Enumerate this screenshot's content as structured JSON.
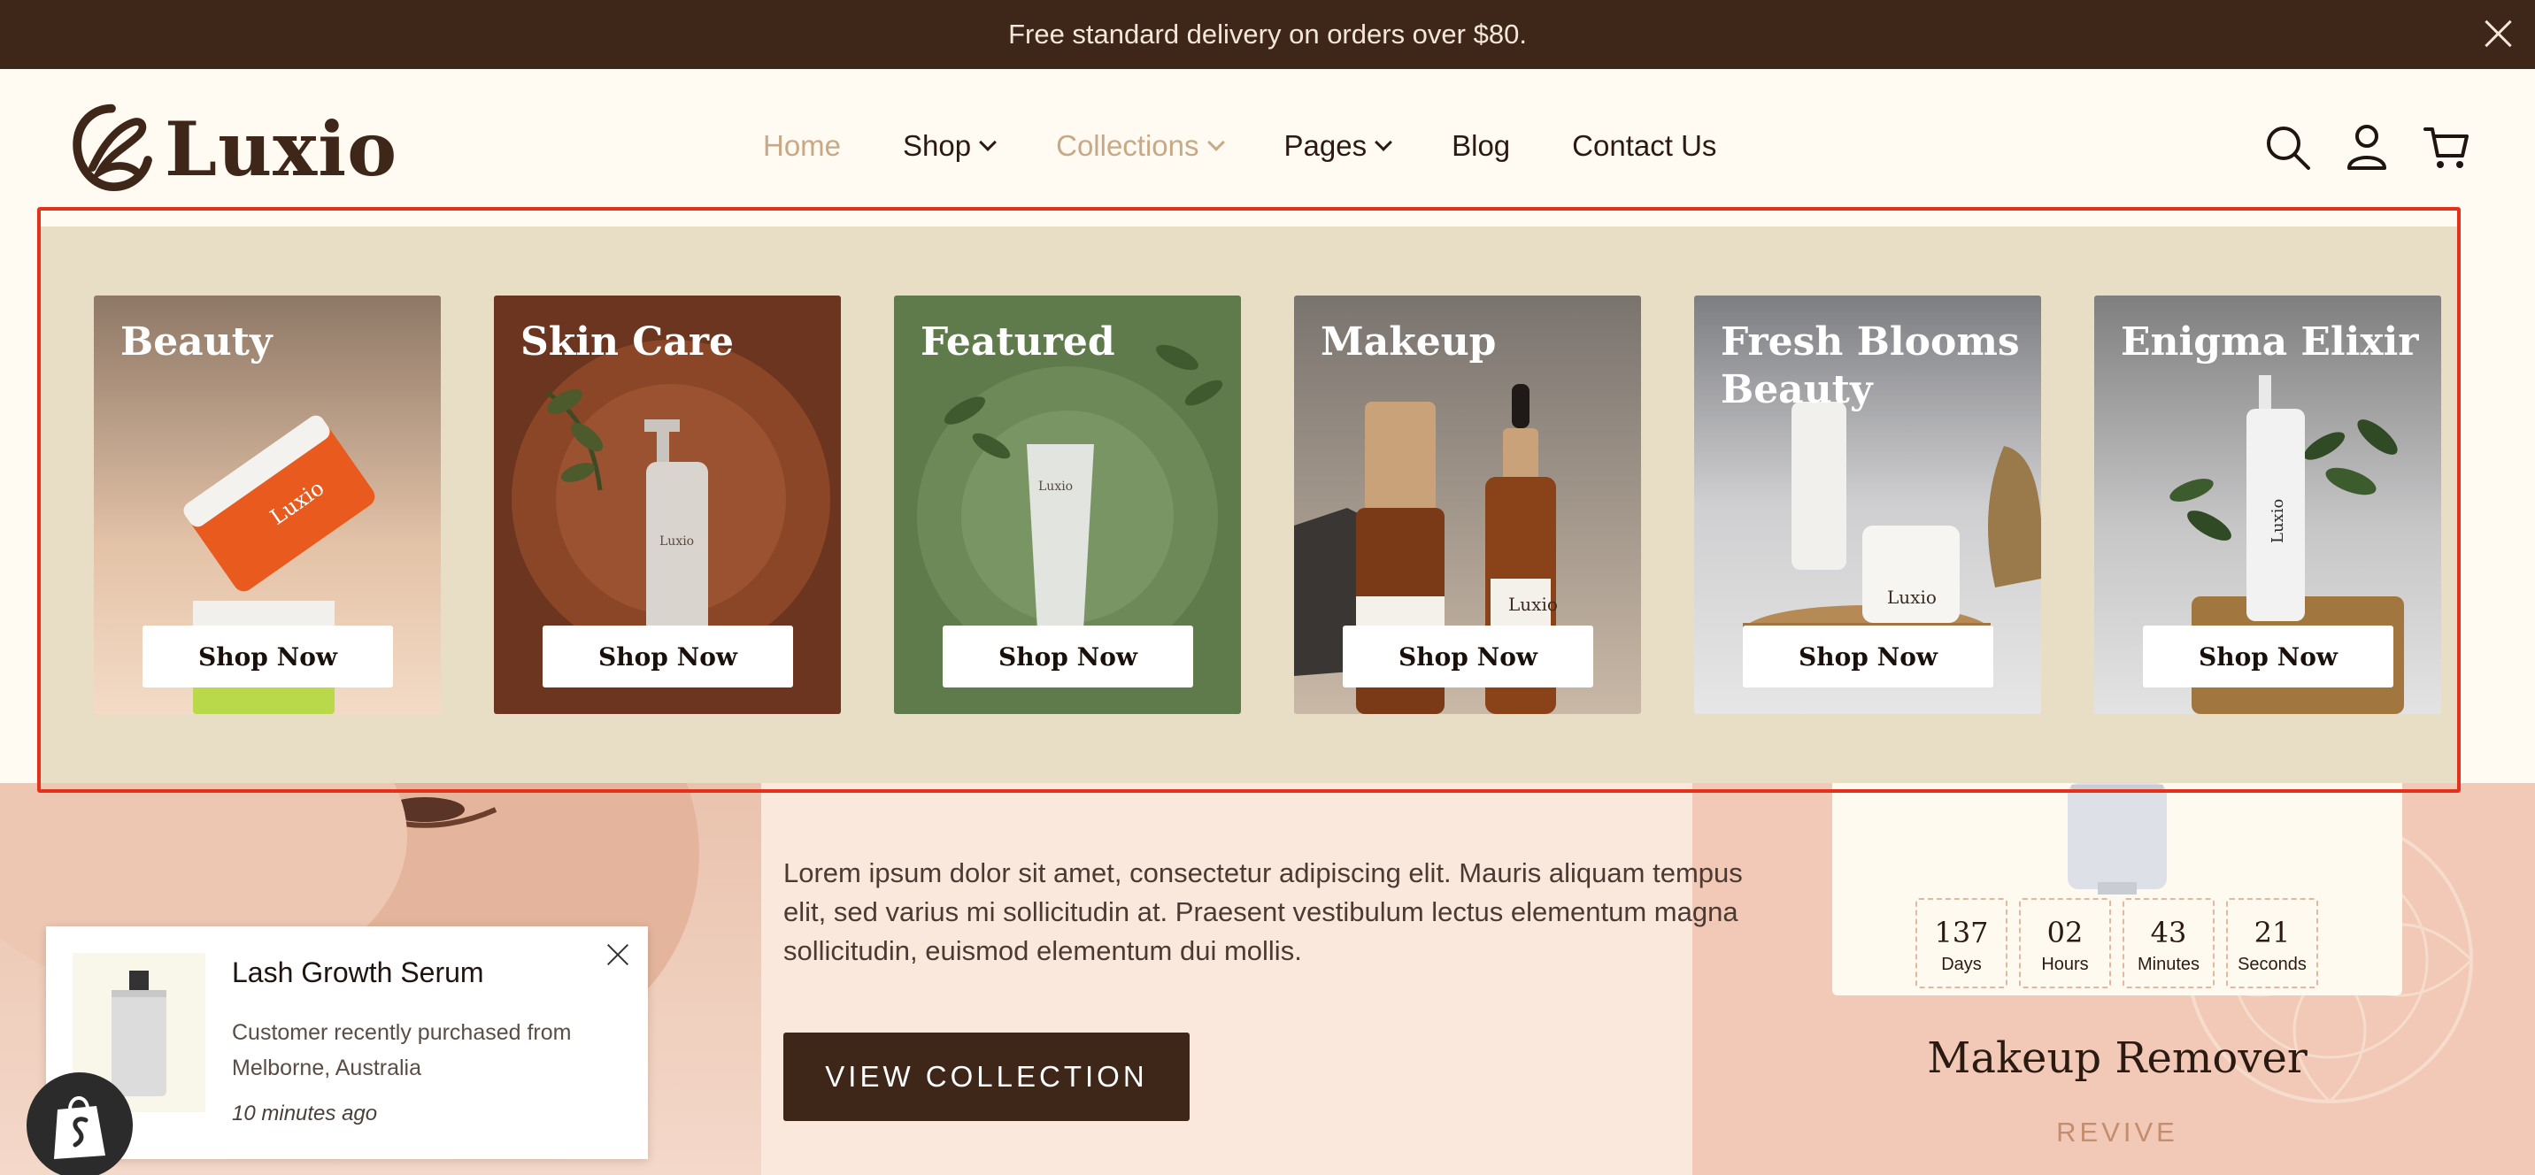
{
  "announcement": {
    "text": "Free standard delivery on orders over $80."
  },
  "brand": {
    "name": "Luxio"
  },
  "nav": {
    "items": [
      {
        "label": "Home"
      },
      {
        "label": "Shop"
      },
      {
        "label": "Collections"
      },
      {
        "label": "Pages"
      },
      {
        "label": "Blog"
      },
      {
        "label": "Contact Us"
      }
    ]
  },
  "collections": [
    {
      "title": "Beauty",
      "button": "Shop Now"
    },
    {
      "title": "Skin Care",
      "button": "Shop Now"
    },
    {
      "title": "Featured",
      "button": "Shop Now"
    },
    {
      "title": "Makeup",
      "button": "Shop Now"
    },
    {
      "title": "Fresh Blooms Beauty",
      "button": "Shop Now"
    },
    {
      "title": "Enigma Elixir",
      "button": "Shop Now"
    }
  ],
  "product_label": "Luxio",
  "hero": {
    "text": "Lorem ipsum dolor sit amet, consectetur adipiscing elit. Mauris aliquam tempus elit, sed varius mi sollicitudin at. Praesent vestibulum lectus elementum magna sollicitudin, euismod elementum dui mollis.",
    "button": "VIEW COLLECTION"
  },
  "countdown": [
    {
      "value": "137",
      "label": "Days"
    },
    {
      "value": "02",
      "label": "Hours"
    },
    {
      "value": "43",
      "label": "Minutes"
    },
    {
      "value": "21",
      "label": "Seconds"
    }
  ],
  "product": {
    "title": "Makeup Remover",
    "subtitle": "REVIVE"
  },
  "popup": {
    "title": "Lash Growth Serum",
    "text": "Customer recently purchased  from Melborne, Australia",
    "time": "10 minutes ago"
  },
  "colors": {
    "announcement_bg": "#3e2619",
    "accent": "#c7a986",
    "mega_bg": "#e8ddc5",
    "highlight_outline": "#e5301c"
  }
}
